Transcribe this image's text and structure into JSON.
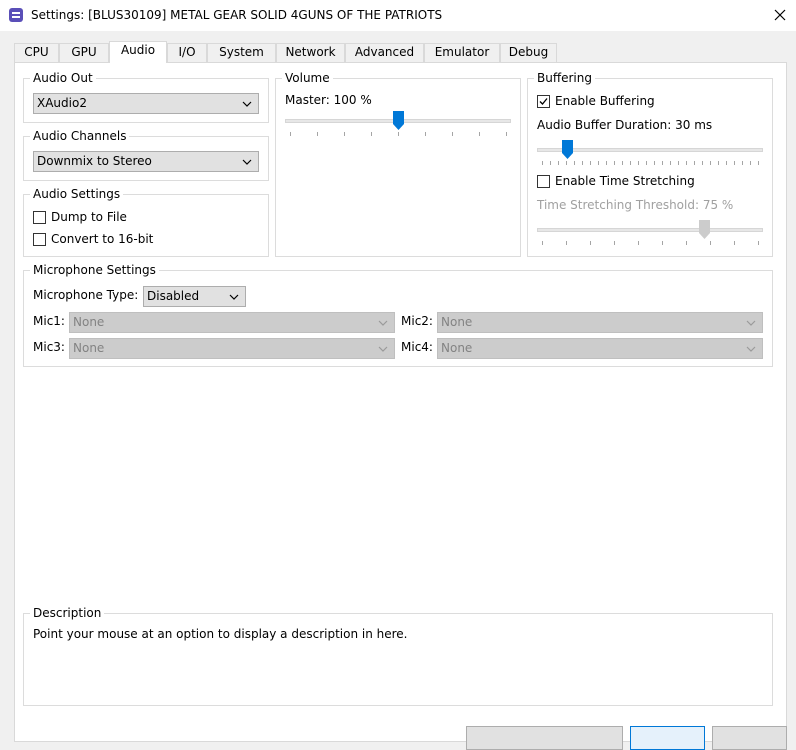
{
  "window": {
    "title": "Settings: [BLUS30109] METAL GEAR SOLID 4GUNS OF THE PATRIOTS",
    "icon": "rpcs3-app-icon",
    "close_icon": "close-icon"
  },
  "tabs": [
    {
      "label": "CPU"
    },
    {
      "label": "GPU"
    },
    {
      "label": "Audio",
      "active": true
    },
    {
      "label": "I/O"
    },
    {
      "label": "System"
    },
    {
      "label": "Network"
    },
    {
      "label": "Advanced"
    },
    {
      "label": "Emulator"
    },
    {
      "label": "Debug"
    }
  ],
  "audio_out": {
    "title": "Audio Out",
    "selected": "XAudio2"
  },
  "audio_channels": {
    "title": "Audio Channels",
    "selected": "Downmix to Stereo"
  },
  "audio_settings": {
    "title": "Audio Settings",
    "dump_to_file": {
      "label": "Dump to File",
      "checked": false
    },
    "convert_16bit": {
      "label": "Convert to 16-bit",
      "checked": false
    }
  },
  "volume": {
    "title": "Volume",
    "master_label": "Master: 100 %",
    "master_value": 100,
    "master_min": 0,
    "master_max": 200
  },
  "buffering": {
    "title": "Buffering",
    "enable_buffering": {
      "label": "Enable Buffering",
      "checked": true
    },
    "duration_label": "Audio Buffer Duration: 30 ms",
    "duration_value": 30,
    "enable_time_stretching": {
      "label": "Enable Time Stretching",
      "checked": false
    },
    "threshold_label": "Time Stretching Threshold: 75 %",
    "threshold_value": 75
  },
  "microphone": {
    "title": "Microphone Settings",
    "type_label": "Microphone Type:",
    "type_selected": "Disabled",
    "mic1_label": "Mic1:",
    "mic1_value": "None",
    "mic2_label": "Mic2:",
    "mic2_value": "None",
    "mic3_label": "Mic3:",
    "mic3_value": "None",
    "mic4_label": "Mic4:",
    "mic4_value": "None"
  },
  "description": {
    "title": "Description",
    "text": "Point your mouse at an option to display a description in here."
  },
  "colors": {
    "accent": "#0078d7",
    "disabled_thumb": "#cccccc"
  }
}
